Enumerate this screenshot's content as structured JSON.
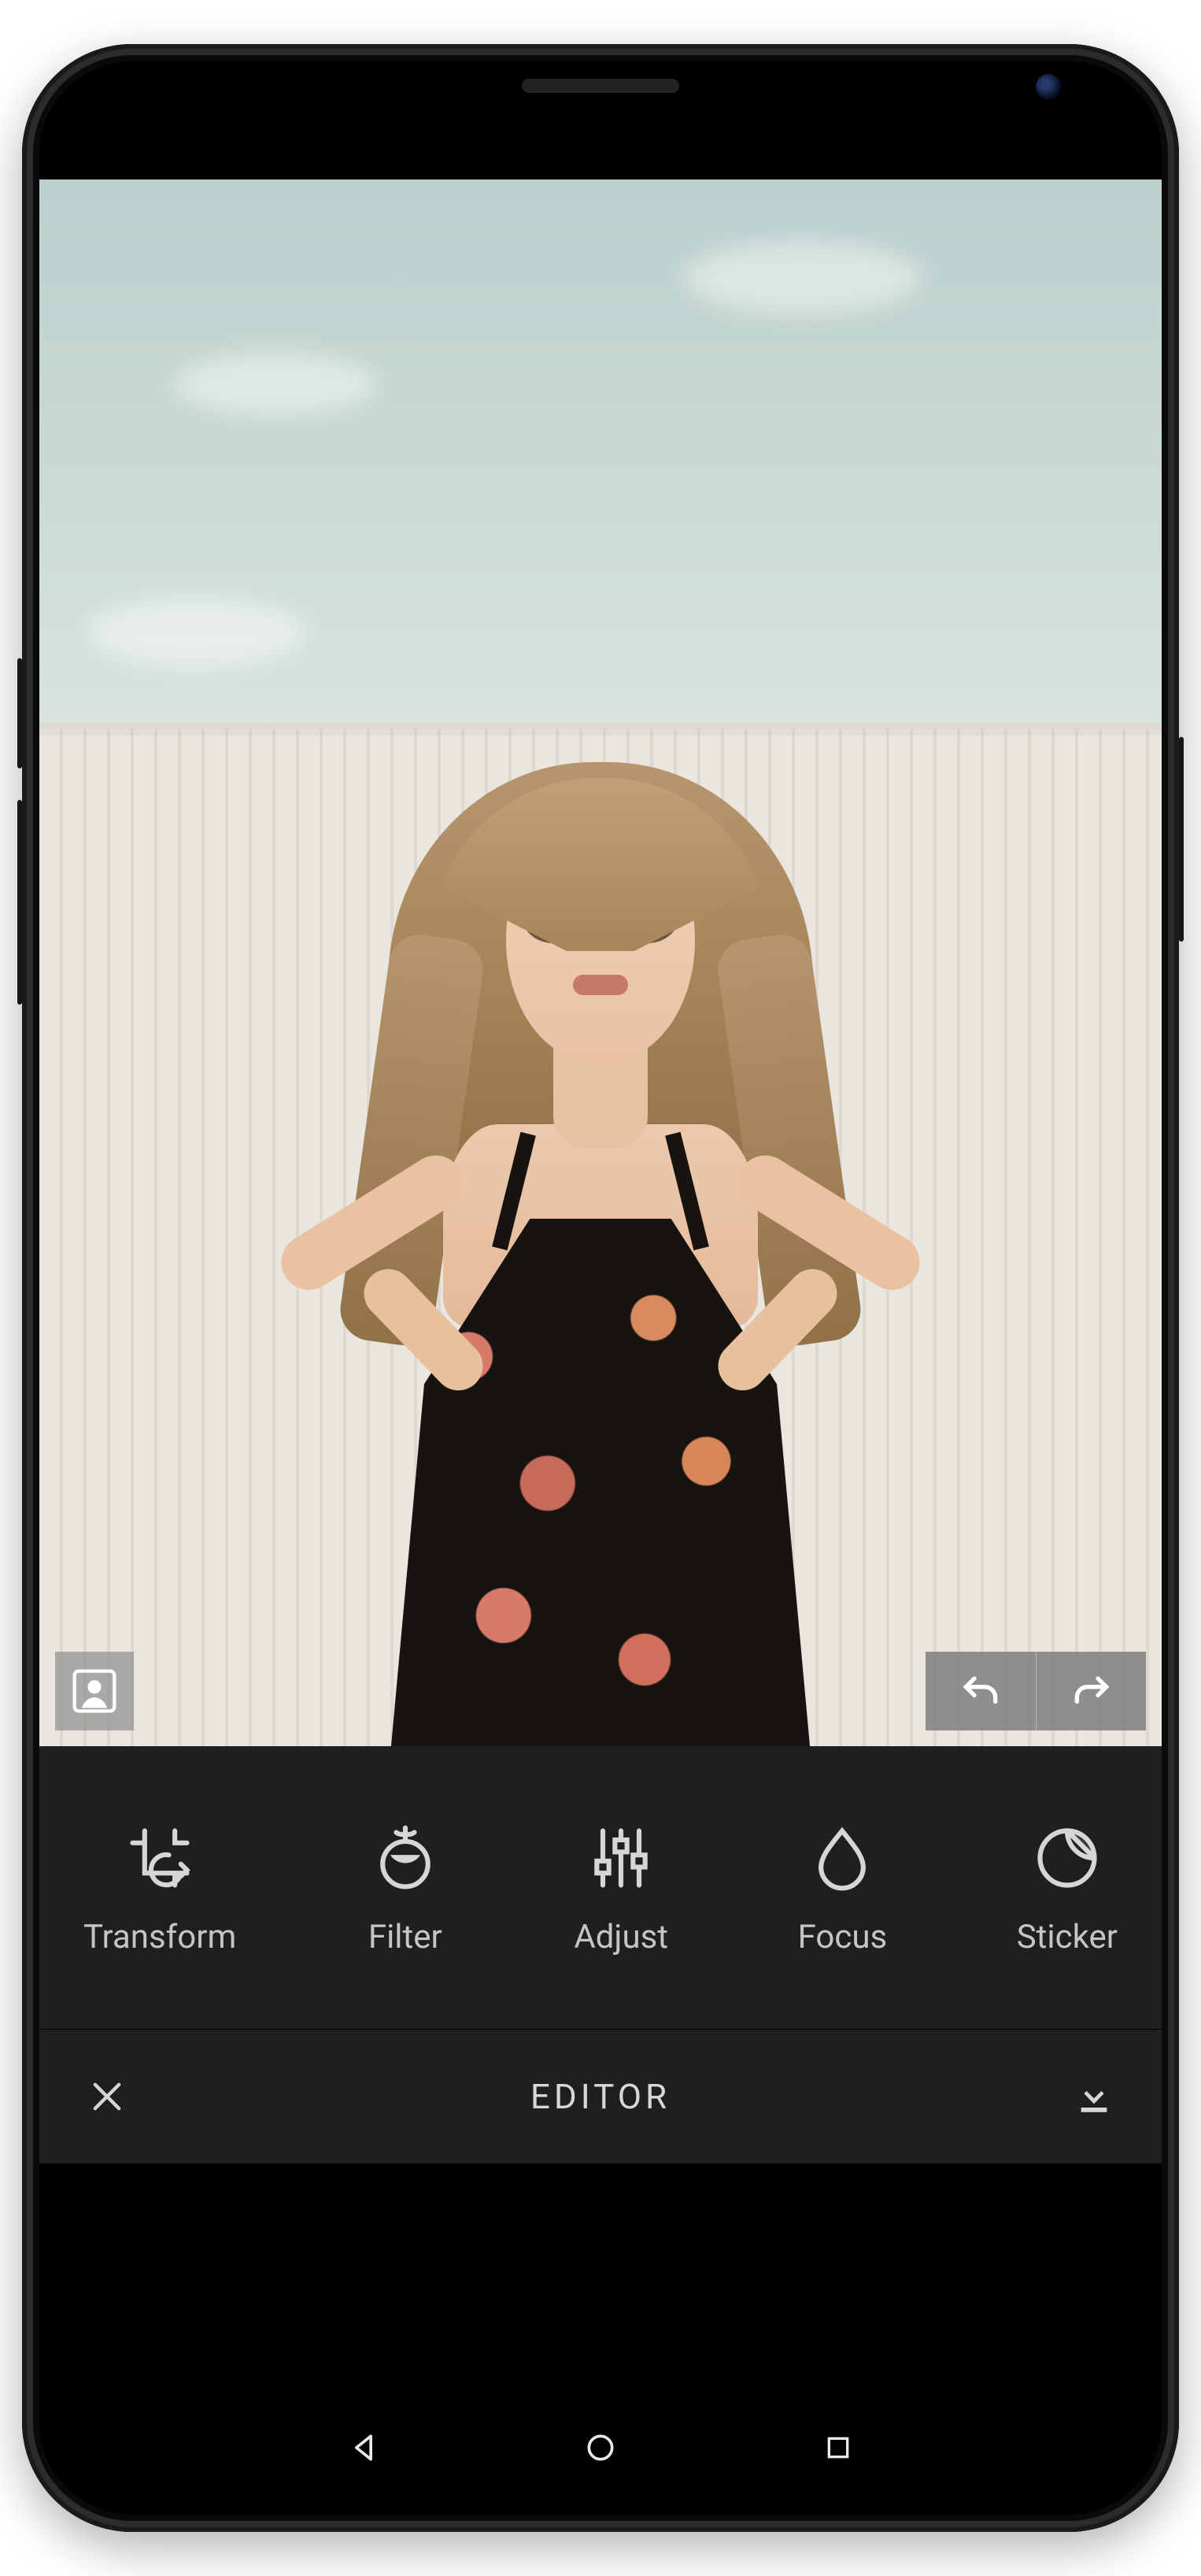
{
  "tools": [
    {
      "id": "transform",
      "label": "Transform",
      "icon": "transform-icon"
    },
    {
      "id": "filter",
      "label": "Filter",
      "icon": "filter-icon"
    },
    {
      "id": "adjust",
      "label": "Adjust",
      "icon": "adjust-icon"
    },
    {
      "id": "focus",
      "label": "Focus",
      "icon": "focus-icon"
    },
    {
      "id": "sticker",
      "label": "Sticker",
      "icon": "sticker-icon"
    }
  ],
  "editor_bar": {
    "title": "EDITOR",
    "close_icon": "close-icon",
    "save_icon": "download-icon"
  },
  "overlay": {
    "profile_icon": "profile-framed-icon",
    "undo_icon": "undo-icon",
    "redo_icon": "redo-icon"
  },
  "nav": {
    "back_icon": "triangle-back-icon",
    "home_icon": "circle-home-icon",
    "recent_icon": "square-recent-icon"
  }
}
